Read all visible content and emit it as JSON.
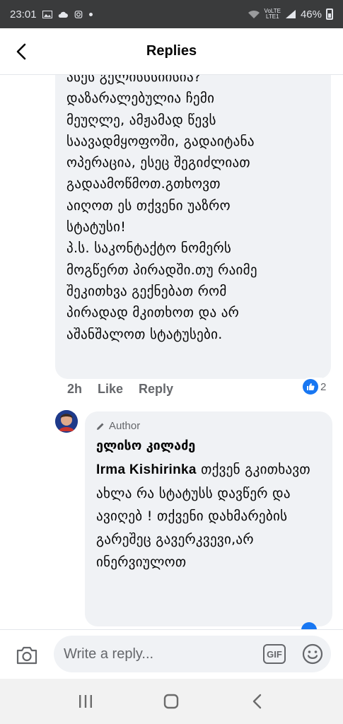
{
  "status_bar": {
    "time": "23:01",
    "network_top": "VoLTE",
    "network_bottom": "LTE1",
    "battery": "46%"
  },
  "header": {
    "title": "Replies",
    "back_icon": "back-arrow-icon"
  },
  "comment": {
    "text": "ასეს გელისსსიისია?\nდაზარალებულია ჩემი\nმეუღლე, ამჟამად წევს\nსაავადმყოფოში, გადაიტანა\nოპერაცია, ესეც შეგიძლიათ\nგადაამოწმოთ.გთხოვთ\nაიღოთ ეს თქვენი უაზრო\nსტატუსი!\nპ.ს. საკონტაქტო ნომერს\nმოგწერთ პირადში.თუ რაიმე\nშეკითხვა გექნებათ რომ\nპირადად მკითხოთ და არ\nაშანშალოთ სტატუსები.",
    "time": "2h",
    "like_label": "Like",
    "reply_label": "Reply",
    "reaction_count": "2"
  },
  "reply": {
    "author_badge": "Author",
    "name": "ელისო კილაძე",
    "mention": "Irma Kishirinka",
    "text": " თქვენ გკითხავთ ახლა რა სტატუსს დავწერ და ავიღებ ! თქვენი დახმარების გარეშეც გავერკვევი,არ ინერვიულოთ"
  },
  "composer": {
    "placeholder": "Write a reply...",
    "gif_label": "GIF"
  },
  "colors": {
    "status_bar_bg": "#3a3b3c",
    "bubble_bg": "#f0f2f5",
    "secondary_text": "#65676b",
    "like_blue": "#1877f2"
  }
}
